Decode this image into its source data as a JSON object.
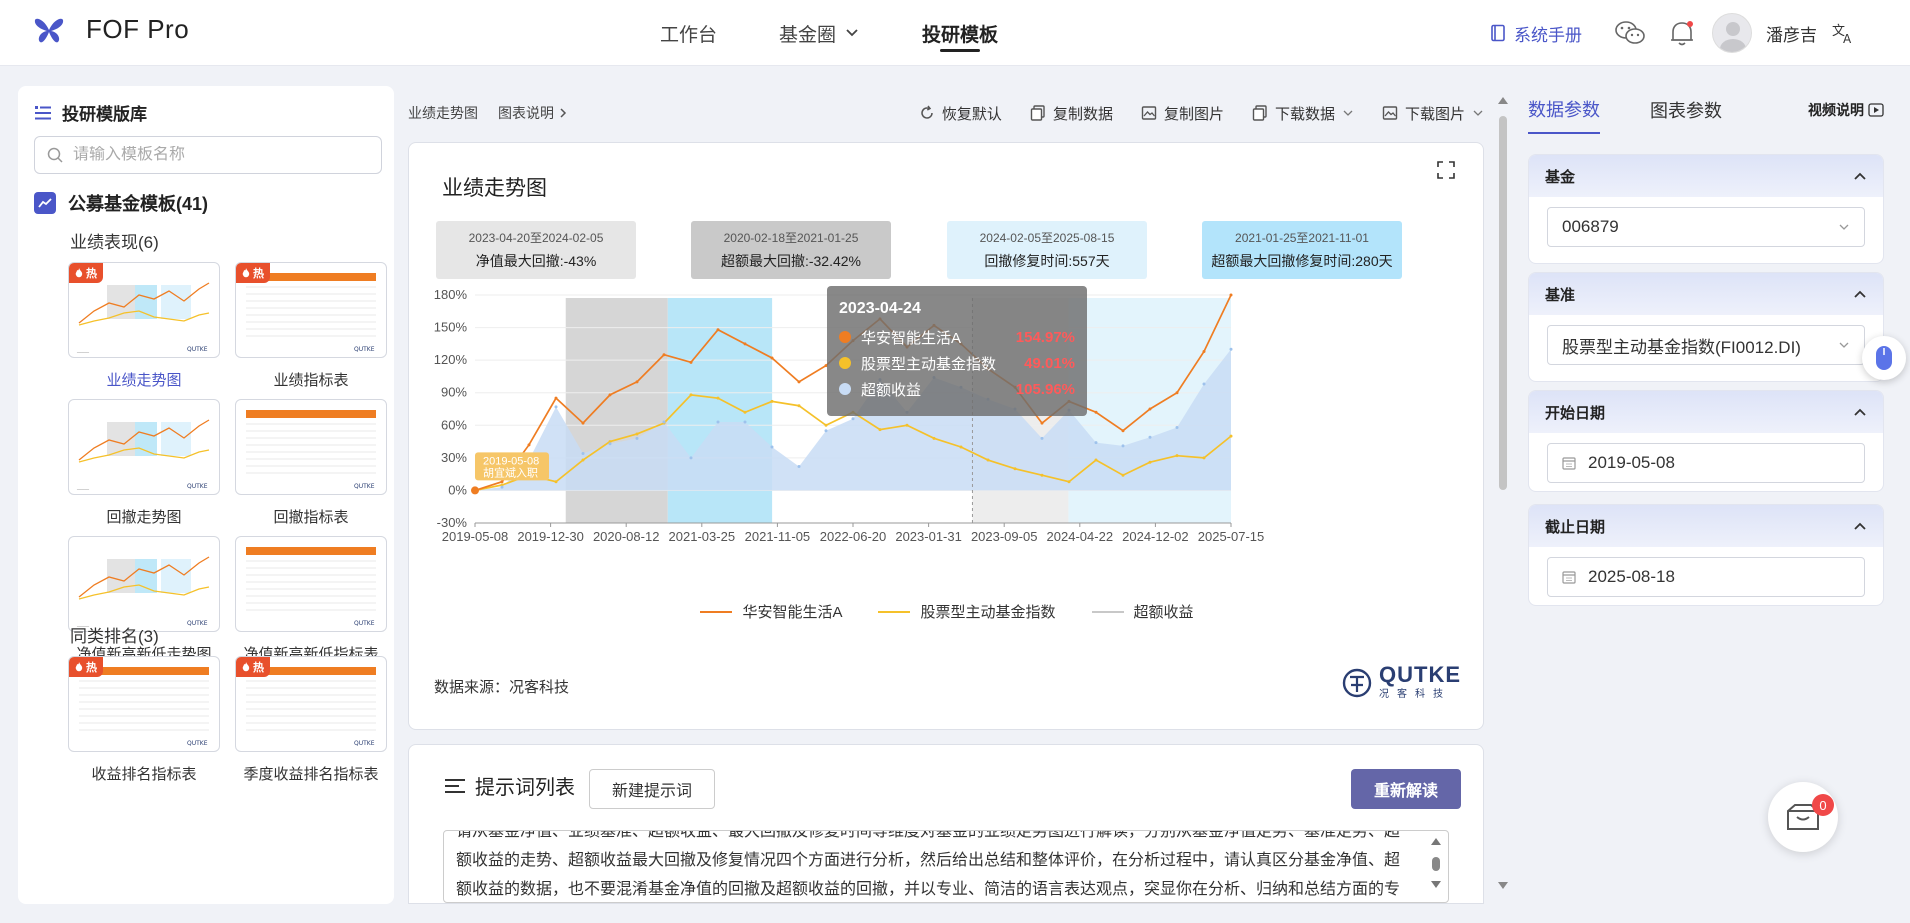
{
  "app": {
    "name": "FOF Pro",
    "brand_color": "#4a56c8"
  },
  "nav": {
    "items": [
      "工作台",
      "基金圈",
      "投研模板"
    ],
    "active": "投研模板"
  },
  "topright": {
    "manual": "系统手册",
    "username": "潘彦吉"
  },
  "sidebar": {
    "title": "投研模版库",
    "search_placeholder": "请输入模板名称",
    "category": "公募基金模板(41)",
    "groups": [
      {
        "name": "业绩表现(6)",
        "items": [
          {
            "label": "业绩走势图",
            "hot": true,
            "selected": true,
            "kind": "line"
          },
          {
            "label": "业绩指标表",
            "hot": true,
            "selected": false,
            "kind": "table"
          },
          {
            "label": "回撤走势图",
            "hot": false,
            "selected": false,
            "kind": "line"
          },
          {
            "label": "回撤指标表",
            "hot": false,
            "selected": false,
            "kind": "table"
          },
          {
            "label": "净值新高新低走势图",
            "hot": false,
            "selected": false,
            "kind": "line"
          },
          {
            "label": "净值新高新低指标表",
            "hot": false,
            "selected": false,
            "kind": "table"
          }
        ]
      },
      {
        "name": "同类排名(3)",
        "items": [
          {
            "label": "收益排名指标表",
            "hot": true,
            "selected": false,
            "kind": "table"
          },
          {
            "label": "季度收益排名指标表",
            "hot": true,
            "selected": false,
            "kind": "table"
          }
        ]
      }
    ],
    "hot_label": "热"
  },
  "toolbar": {
    "crumb1": "业绩走势图",
    "crumb2": "图表说明",
    "restore": "恢复默认",
    "copy_data": "复制数据",
    "copy_image": "复制图片",
    "download_data": "下载数据",
    "download_image": "下载图片"
  },
  "chart": {
    "title": "业绩走势图",
    "annotations": [
      {
        "date": "2023-04-20至2024-02-05",
        "value": "净值最大回撤:-43%"
      },
      {
        "date": "2020-02-18至2021-01-25",
        "value": "超额最大回撤:-32.42%"
      },
      {
        "date": "2024-02-05至2025-08-15",
        "value": "回撤修复时间:557天"
      },
      {
        "date": "2021-01-25至2021-11-01",
        "value": "超额最大回撤修复时间:280天"
      }
    ],
    "tooltip": {
      "date": "2023-04-24",
      "rows": [
        {
          "name": "华安智能生活A",
          "value": "154.97%"
        },
        {
          "name": "股票型主动基金指数",
          "value": "49.01%"
        },
        {
          "name": "超额收益",
          "value": "105.96%"
        }
      ]
    },
    "marker": {
      "date": "2019-05-08",
      "text": "胡宜斌入职"
    },
    "source": "数据来源：况客科技",
    "logo_text": "QUTKE",
    "logo_sub": "况客科技",
    "colors": {
      "fund": "#ef7d22",
      "index": "#f5c12a",
      "excess": "#c8dcf5"
    }
  },
  "chart_data": {
    "type": "line",
    "x_ticks": [
      "2019-05-08",
      "2019-12-30",
      "2020-08-12",
      "2021-03-25",
      "2021-11-05",
      "2022-06-20",
      "2023-01-31",
      "2023-09-05",
      "2024-04-22",
      "2024-12-02",
      "2025-07-15"
    ],
    "ylim": [
      -30,
      180
    ],
    "y_ticks": [
      "180%",
      "150%",
      "120%",
      "90%",
      "60%",
      "30%",
      "0%",
      "-30%"
    ],
    "series": [
      {
        "name": "华安智能生活A",
        "type": "line",
        "values": [
          0,
          8,
          42,
          85,
          62,
          88,
          100,
          125,
          118,
          148,
          135,
          122,
          100,
          115,
          138,
          158,
          132,
          152,
          135,
          112,
          95,
          62,
          82,
          72,
          55,
          75,
          90,
          128,
          180
        ]
      },
      {
        "name": "股票型主动基金指数",
        "type": "line",
        "values": [
          0,
          5,
          14,
          8,
          28,
          45,
          52,
          62,
          88,
          85,
          72,
          82,
          78,
          60,
          72,
          56,
          60,
          48,
          40,
          28,
          20,
          14,
          8,
          28,
          14,
          26,
          32,
          30,
          50
        ]
      },
      {
        "name": "超额收益",
        "type": "area",
        "values": [
          0,
          3,
          28,
          77,
          34,
          43,
          48,
          63,
          30,
          63,
          63,
          40,
          22,
          55,
          66,
          102,
          72,
          104,
          95,
          84,
          75,
          48,
          74,
          44,
          41,
          49,
          58,
          98,
          130
        ]
      }
    ],
    "legend": [
      "华安智能生活A",
      "股票型主动基金指数",
      "超额收益"
    ]
  },
  "prompt": {
    "title": "提示词列表",
    "new_button": "新建提示词",
    "reread_button": "重新解读",
    "text": "请从基金净值、业绩基准、超额收益、最大回撤及修复时间等维度对基金的业绩走势图进行解读，分别从基金净值走势、基准走势、超额收益的走势、超额收益最大回撤及修复情况四个方面进行分析，然后给出总结和整体评价，在分析过程中，请认真区分基金净值、超额收益的数据，也不要混淆基金净值的回撤及超额收益的回撤，并以专业、简洁的语言表达观点，突显你在分析、归纳和总结方面的专长。"
  },
  "right": {
    "tabs": [
      "数据参数",
      "图表参数"
    ],
    "video": "视频说明",
    "fund_label": "基金",
    "fund_value": "006879",
    "bench_label": "基准",
    "bench_value": "股票型主动基金指数(FI0012.DI)",
    "start_label": "开始日期",
    "start_value": "2019-05-08",
    "end_label": "截止日期",
    "end_value": "2025-08-18"
  },
  "cart_count": "0"
}
